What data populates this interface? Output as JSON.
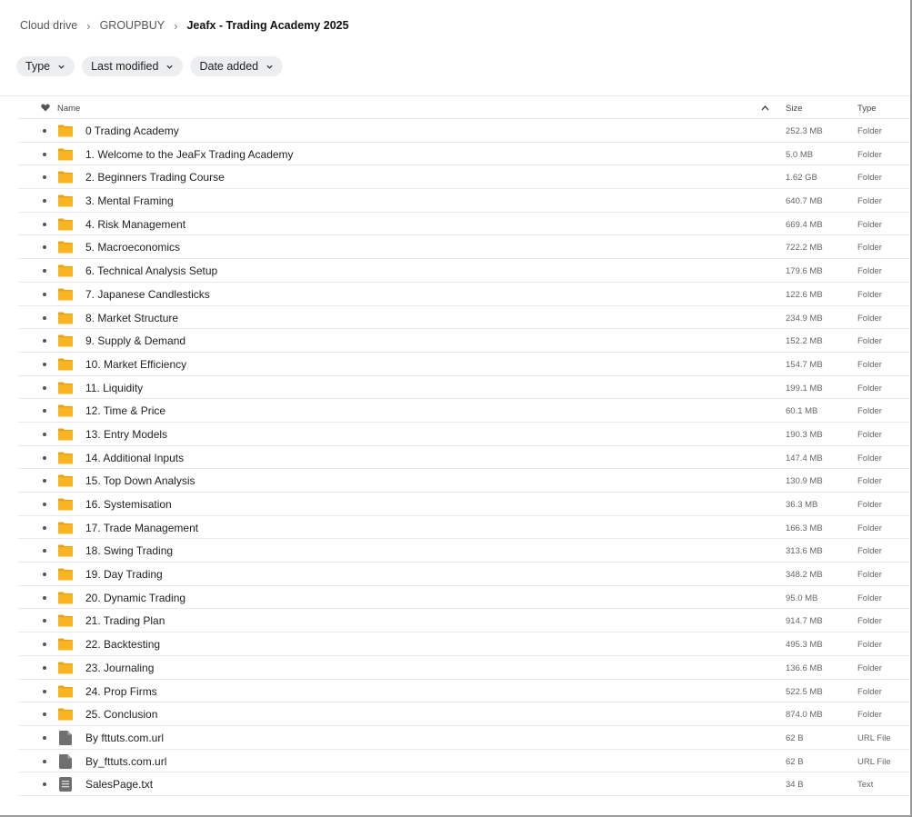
{
  "breadcrumb": {
    "items": [
      "Cloud drive",
      "GROUPBUY",
      "Jeafx - Trading Academy 2025"
    ]
  },
  "filters": {
    "items": [
      "Type",
      "Last modified",
      "Date added"
    ]
  },
  "table": {
    "headers": {
      "name": "Name",
      "size": "Size",
      "type": "Type"
    },
    "rows": [
      {
        "name": "0 Trading Academy",
        "size": "252.3 MB",
        "type": "Folder",
        "icon": "folder-icon"
      },
      {
        "name": "1. Welcome to the JeaFx Trading Academy",
        "size": "5.0 MB",
        "type": "Folder",
        "icon": "folder-icon"
      },
      {
        "name": "2. Beginners Trading Course",
        "size": "1.62 GB",
        "type": "Folder",
        "icon": "folder-icon"
      },
      {
        "name": "3. Mental Framing",
        "size": "640.7 MB",
        "type": "Folder",
        "icon": "folder-icon"
      },
      {
        "name": "4. Risk Management",
        "size": "669.4 MB",
        "type": "Folder",
        "icon": "folder-icon"
      },
      {
        "name": "5. Macroeconomics",
        "size": "722.2 MB",
        "type": "Folder",
        "icon": "folder-icon"
      },
      {
        "name": "6. Technical Analysis Setup",
        "size": "179.6 MB",
        "type": "Folder",
        "icon": "folder-icon"
      },
      {
        "name": "7. Japanese Candlesticks",
        "size": "122.6 MB",
        "type": "Folder",
        "icon": "folder-icon"
      },
      {
        "name": "8. Market Structure",
        "size": "234.9 MB",
        "type": "Folder",
        "icon": "folder-icon"
      },
      {
        "name": "9. Supply & Demand",
        "size": "152.2 MB",
        "type": "Folder",
        "icon": "folder-icon"
      },
      {
        "name": "10. Market Efficiency",
        "size": "154.7 MB",
        "type": "Folder",
        "icon": "folder-icon"
      },
      {
        "name": "11. Liquidity",
        "size": "199.1 MB",
        "type": "Folder",
        "icon": "folder-icon"
      },
      {
        "name": "12. Time & Price",
        "size": "60.1 MB",
        "type": "Folder",
        "icon": "folder-icon"
      },
      {
        "name": "13. Entry Models",
        "size": "190.3 MB",
        "type": "Folder",
        "icon": "folder-icon"
      },
      {
        "name": "14. Additional Inputs",
        "size": "147.4 MB",
        "type": "Folder",
        "icon": "folder-icon"
      },
      {
        "name": "15. Top Down Analysis",
        "size": "130.9 MB",
        "type": "Folder",
        "icon": "folder-icon"
      },
      {
        "name": "16. Systemisation",
        "size": "36.3 MB",
        "type": "Folder",
        "icon": "folder-icon"
      },
      {
        "name": "17. Trade Management",
        "size": "166.3 MB",
        "type": "Folder",
        "icon": "folder-icon"
      },
      {
        "name": "18. Swing Trading",
        "size": "313.6 MB",
        "type": "Folder",
        "icon": "folder-icon"
      },
      {
        "name": "19. Day Trading",
        "size": "348.2 MB",
        "type": "Folder",
        "icon": "folder-icon"
      },
      {
        "name": "20. Dynamic Trading",
        "size": "95.0 MB",
        "type": "Folder",
        "icon": "folder-icon"
      },
      {
        "name": "21. Trading Plan",
        "size": "914.7 MB",
        "type": "Folder",
        "icon": "folder-icon"
      },
      {
        "name": "22. Backtesting",
        "size": "495.3 MB",
        "type": "Folder",
        "icon": "folder-icon"
      },
      {
        "name": "23. Journaling",
        "size": "136.6 MB",
        "type": "Folder",
        "icon": "folder-icon"
      },
      {
        "name": "24. Prop Firms",
        "size": "522.5 MB",
        "type": "Folder",
        "icon": "folder-icon"
      },
      {
        "name": "25. Conclusion",
        "size": "874.0 MB",
        "type": "Folder",
        "icon": "folder-icon"
      },
      {
        "name": "By fttuts.com.url",
        "size": "62 B",
        "type": "URL File",
        "icon": "file-icon"
      },
      {
        "name": "By_fttuts.com.url",
        "size": "62 B",
        "type": "URL File",
        "icon": "file-icon"
      },
      {
        "name": "SalesPage.txt",
        "size": "34 B",
        "type": "Text",
        "icon": "text-file-icon"
      }
    ]
  },
  "colors": {
    "folder": "#f9b520",
    "folder_dark": "#e8a20f",
    "file": "#6f6f6f",
    "chip_bg": "#eceef0"
  }
}
